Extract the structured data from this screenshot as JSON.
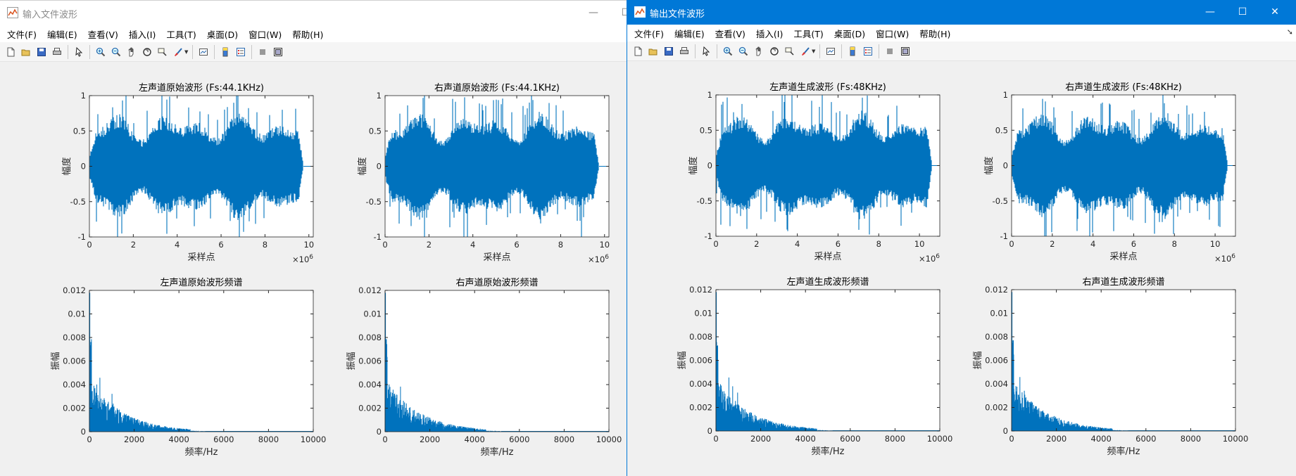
{
  "windows": [
    {
      "id": "left",
      "title": "输入文件波形",
      "controls": {
        "minimize": "—",
        "maximize": "☐"
      },
      "menus": [
        "文件(F)",
        "编辑(E)",
        "查看(V)",
        "插入(I)",
        "工具(T)",
        "桌面(D)",
        "窗口(W)",
        "帮助(H)"
      ],
      "figure": {
        "plots": [
          {
            "kind": "wave",
            "title": "左声道原始波形 (Fs:44.1KHz)",
            "xlabel": "采样点",
            "ylabel": "幅度",
            "xticks": [
              "0",
              "2",
              "4",
              "6",
              "8",
              "10"
            ],
            "yticks": [
              "1",
              "0.5",
              "0",
              "-0.5",
              "-1"
            ],
            "xlim": [
              0,
              10.2
            ],
            "ylim": [
              -1,
              1
            ],
            "exponent": "×10^6",
            "signal_end": 9.75
          },
          {
            "kind": "wave",
            "title": "右声道原始波形 (Fs:44.1KHz)",
            "xlabel": "采样点",
            "ylabel": "幅度",
            "xticks": [
              "0",
              "2",
              "4",
              "6",
              "8",
              "10"
            ],
            "yticks": [
              "1",
              "0.5",
              "0",
              "-0.5",
              "-1"
            ],
            "xlim": [
              0,
              10.2
            ],
            "ylim": [
              -1,
              1
            ],
            "exponent": "×10^6",
            "signal_end": 9.75
          },
          {
            "kind": "spectrum",
            "title": "左声道原始波形频谱",
            "xlabel": "频率/Hz",
            "ylabel": "振幅",
            "xticks": [
              "0",
              "2000",
              "4000",
              "6000",
              "8000",
              "10000"
            ],
            "yticks": [
              "0.012",
              "0.01",
              "0.008",
              "0.006",
              "0.004",
              "0.002",
              "0"
            ],
            "xlim": [
              0,
              10000
            ],
            "ylim": [
              0,
              0.012
            ]
          },
          {
            "kind": "spectrum",
            "title": "右声道原始波形频谱",
            "xlabel": "频率/Hz",
            "ylabel": "振幅",
            "xticks": [
              "0",
              "2000",
              "4000",
              "6000",
              "8000",
              "10000"
            ],
            "yticks": [
              "0.012",
              "0.01",
              "0.008",
              "0.006",
              "0.004",
              "0.002",
              "0"
            ],
            "xlim": [
              0,
              10000
            ],
            "ylim": [
              0,
              0.012
            ]
          }
        ]
      }
    },
    {
      "id": "right",
      "title": "输出文件波形",
      "controls": {
        "minimize": "—",
        "maximize": "☐",
        "close": "✕"
      },
      "menus": [
        "文件(F)",
        "编辑(E)",
        "查看(V)",
        "插入(I)",
        "工具(T)",
        "桌面(D)",
        "窗口(W)",
        "帮助(H)"
      ],
      "figure": {
        "plots": [
          {
            "kind": "wave",
            "title": "左声道生成波形 (Fs:48KHz)",
            "xlabel": "采样点",
            "ylabel": "幅度",
            "xticks": [
              "0",
              "2",
              "4",
              "6",
              "8",
              "10"
            ],
            "yticks": [
              "1",
              "0.5",
              "0",
              "-0.5",
              "-1"
            ],
            "xlim": [
              0,
              11.0
            ],
            "ylim": [
              -1,
              1
            ],
            "exponent": "×10^6",
            "signal_end": 10.6
          },
          {
            "kind": "wave",
            "title": "右声道生成波形 (Fs:48KHz)",
            "xlabel": "采样点",
            "ylabel": "幅度",
            "xticks": [
              "0",
              "2",
              "4",
              "6",
              "8",
              "10"
            ],
            "yticks": [
              "1",
              "0.5",
              "0",
              "-0.5",
              "-1"
            ],
            "xlim": [
              0,
              11.0
            ],
            "ylim": [
              -1,
              1
            ],
            "exponent": "×10^6",
            "signal_end": 10.6
          },
          {
            "kind": "spectrum",
            "title": "左声道生成波形频谱",
            "xlabel": "频率/Hz",
            "ylabel": "振幅",
            "xticks": [
              "0",
              "2000",
              "4000",
              "6000",
              "8000",
              "10000"
            ],
            "yticks": [
              "0.012",
              "0.01",
              "0.008",
              "0.006",
              "0.004",
              "0.002",
              "0"
            ],
            "xlim": [
              0,
              10000
            ],
            "ylim": [
              0,
              0.012
            ]
          },
          {
            "kind": "spectrum",
            "title": "右声道生成波形频谱",
            "xlabel": "频率/Hz",
            "ylabel": "振幅",
            "xticks": [
              "0",
              "2000",
              "4000",
              "6000",
              "8000",
              "10000"
            ],
            "yticks": [
              "0.012",
              "0.01",
              "0.008",
              "0.006",
              "0.004",
              "0.002",
              "0"
            ],
            "xlim": [
              0,
              10000
            ],
            "ylim": [
              0,
              0.012
            ]
          }
        ]
      }
    }
  ],
  "toolbar_icons": [
    "new-figure-icon",
    "open-file-icon",
    "save-icon",
    "print-icon",
    "|",
    "pointer-icon",
    "|",
    "zoom-in-icon",
    "zoom-out-icon",
    "pan-icon",
    "rotate-3d-icon",
    "data-cursor-icon",
    "brush-icon",
    "|",
    "link-plot-icon",
    "|",
    "colorbar-icon",
    "legend-icon",
    "|",
    "hide-plot-tools-icon",
    "show-plot-tools-icon"
  ],
  "colors": {
    "series": "#0072bd",
    "title_bar_active": "#0078d7",
    "axes_bg": "#ffffff",
    "figure_bg": "#f0f0f0"
  },
  "chart_data": [
    {
      "type": "line",
      "title": "左声道原始波形 (Fs:44.1KHz)",
      "xlabel": "采样点",
      "ylabel": "幅度",
      "xlim": [
        0,
        10200000
      ],
      "ylim": [
        -1,
        1
      ],
      "series": [
        {
          "values_note_envelope": [
            [
              0,
              0
            ],
            [
              500000,
              0.8
            ],
            [
              1300000,
              1.0
            ],
            [
              5000000,
              0.95
            ],
            [
              9500000,
              0.9
            ],
            [
              9750000,
              0
            ]
          ]
        }
      ]
    },
    {
      "type": "line",
      "title": "右声道原始波形 (Fs:44.1KHz)",
      "xlabel": "采样点",
      "ylabel": "幅度",
      "xlim": [
        0,
        10200000
      ],
      "ylim": [
        -1,
        1
      ],
      "series": [
        {
          "values_note_envelope": [
            [
              0,
              0
            ],
            [
              500000,
              0.8
            ],
            [
              1500000,
              1.0
            ],
            [
              5000000,
              0.95
            ],
            [
              9500000,
              0.9
            ],
            [
              9750000,
              0
            ]
          ]
        }
      ]
    },
    {
      "type": "line",
      "title": "左声道原始波形频谱",
      "xlabel": "频率/Hz",
      "ylabel": "振幅",
      "xlim": [
        0,
        10000
      ],
      "ylim": [
        0,
        0.012
      ],
      "series": [
        {
          "x": [
            0,
            50,
            100,
            200,
            500,
            1000,
            2000,
            3000,
            4000,
            5000,
            10000
          ],
          "values": [
            0.012,
            0.011,
            0.006,
            0.004,
            0.0025,
            0.003,
            0.0012,
            0.0008,
            0.0004,
            0.0001,
            0
          ]
        }
      ]
    },
    {
      "type": "line",
      "title": "右声道原始波形频谱",
      "xlabel": "频率/Hz",
      "ylabel": "振幅",
      "xlim": [
        0,
        10000
      ],
      "ylim": [
        0,
        0.012
      ],
      "series": [
        {
          "x": [
            0,
            50,
            100,
            200,
            500,
            1000,
            2000,
            3000,
            4000,
            5000,
            10000
          ],
          "values": [
            0.012,
            0.0115,
            0.006,
            0.004,
            0.0025,
            0.0025,
            0.0012,
            0.0008,
            0.0004,
            0.0001,
            0
          ]
        }
      ]
    },
    {
      "type": "line",
      "title": "左声道生成波形 (Fs:48KHz)",
      "xlabel": "采样点",
      "ylabel": "幅度",
      "xlim": [
        0,
        11000000
      ],
      "ylim": [
        -1,
        1
      ],
      "series": [
        {
          "values_note_envelope": [
            [
              0,
              0
            ],
            [
              500000,
              0.8
            ],
            [
              1400000,
              1.0
            ],
            [
              5000000,
              0.95
            ],
            [
              10300000,
              0.9
            ],
            [
              10600000,
              0
            ]
          ]
        }
      ]
    },
    {
      "type": "line",
      "title": "右声道生成波形 (Fs:48KHz)",
      "xlabel": "采样点",
      "ylabel": "幅度",
      "xlim": [
        0,
        11000000
      ],
      "ylim": [
        -1,
        1
      ],
      "series": [
        {
          "values_note_envelope": [
            [
              0,
              0
            ],
            [
              500000,
              0.8
            ],
            [
              1600000,
              1.0
            ],
            [
              5000000,
              0.95
            ],
            [
              10300000,
              0.9
            ],
            [
              10600000,
              0
            ]
          ]
        }
      ]
    },
    {
      "type": "line",
      "title": "左声道生成波形频谱",
      "xlabel": "频率/Hz",
      "ylabel": "振幅",
      "xlim": [
        0,
        10000
      ],
      "ylim": [
        0,
        0.012
      ],
      "series": [
        {
          "x": [
            0,
            50,
            100,
            200,
            500,
            1000,
            2000,
            3000,
            4000,
            5000,
            10000
          ],
          "values": [
            0.012,
            0.011,
            0.006,
            0.004,
            0.0025,
            0.003,
            0.0012,
            0.0008,
            0.0004,
            0.0001,
            0
          ]
        }
      ]
    },
    {
      "type": "line",
      "title": "右声道生成波形频谱",
      "xlabel": "频率/Hz",
      "ylabel": "振幅",
      "xlim": [
        0,
        10000
      ],
      "ylim": [
        0,
        0.012
      ],
      "series": [
        {
          "x": [
            0,
            50,
            100,
            200,
            500,
            1000,
            2000,
            3000,
            4000,
            5000,
            10000
          ],
          "values": [
            0.012,
            0.0115,
            0.006,
            0.004,
            0.0025,
            0.0025,
            0.0012,
            0.0008,
            0.0004,
            0.0001,
            0
          ]
        }
      ]
    }
  ]
}
